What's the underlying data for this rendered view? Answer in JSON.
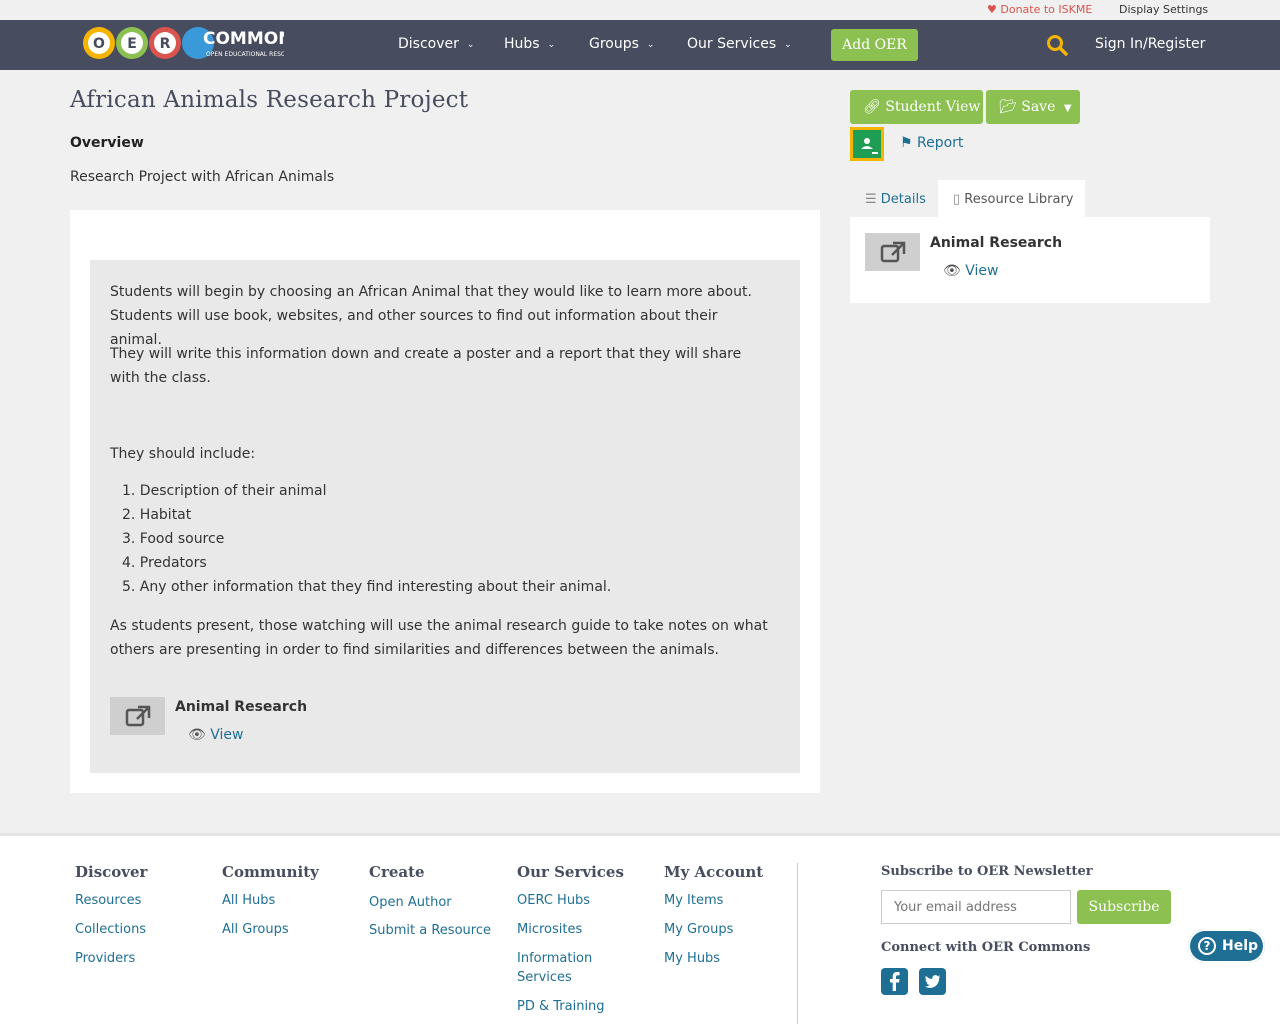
{
  "util": {
    "donate": "Donate to ISKME",
    "display_settings": "Display Settings"
  },
  "nav": {
    "logo": "OER COMMONS",
    "logo_sub": "OPEN EDUCATIONAL RESOURCES",
    "items": [
      {
        "label": "Discover"
      },
      {
        "label": "Hubs"
      },
      {
        "label": "Groups"
      },
      {
        "label": "Our Services"
      }
    ],
    "add_oer": "Add OER",
    "sign_in": "Sign In/Register"
  },
  "page": {
    "title": "African Animals Research Project",
    "overview_heading": "Overview",
    "overview_text": "Research Project with African Animals",
    "paragraph1": "Students will begin by choosing an African Animal that they would like to learn more about. Students will use book, websites, and other sources to find out information about their animal.",
    "paragraph2": "They will write this information down and create a poster and a report that they will share with the class.",
    "include_label": "They should include:",
    "list": [
      "1. Description of their animal",
      "2. Habitat",
      "3. Food source",
      "4. Predators",
      "5. Any other information that they find interesting about their animal."
    ],
    "paragraph3": "As students present, those watching will use the animal research guide to take notes on what others are presenting in order to find similarities and differences between the animals.",
    "resource_name": "Animal Research",
    "resource_view": "View"
  },
  "sidebar": {
    "student_view": "Student View",
    "save": "Save",
    "report": "Report",
    "tab_details": "Details",
    "tab_library": "Resource Library",
    "library_item": "Animal Research",
    "library_view": "View"
  },
  "footer": {
    "discover": {
      "heading": "Discover",
      "links": [
        "Resources",
        "Collections",
        "Providers"
      ]
    },
    "community": {
      "heading": "Community",
      "links": [
        "All Hubs",
        "All Groups"
      ]
    },
    "create": {
      "heading": "Create",
      "links": [
        "Open Author",
        "Submit a Resource"
      ]
    },
    "services": {
      "heading": "Our Services",
      "links": [
        "OERC Hubs",
        "Microsites",
        "Information Services",
        "PD & Training"
      ]
    },
    "account": {
      "heading": "My Account",
      "links": [
        "My Items",
        "My Groups",
        "My Hubs"
      ]
    },
    "newsletter_heading": "Subscribe to OER Newsletter",
    "email_placeholder": "Your email address",
    "subscribe": "Subscribe",
    "connect_heading": "Connect with OER Commons",
    "help": "Help"
  },
  "colors": {
    "navbar": "#474d5e",
    "accent_green": "#8cc152",
    "link_blue": "#1f6f95",
    "donate_red": "#d9534f"
  },
  "icons": [
    "heart-icon",
    "chevron-down-icon",
    "search-icon",
    "link-icon",
    "folder-open-icon",
    "caret-down-icon",
    "google-classroom-icon",
    "flag-icon",
    "list-icon",
    "book-icon",
    "external-link-icon",
    "eye-icon",
    "facebook-icon",
    "twitter-icon",
    "question-circle-icon"
  ]
}
